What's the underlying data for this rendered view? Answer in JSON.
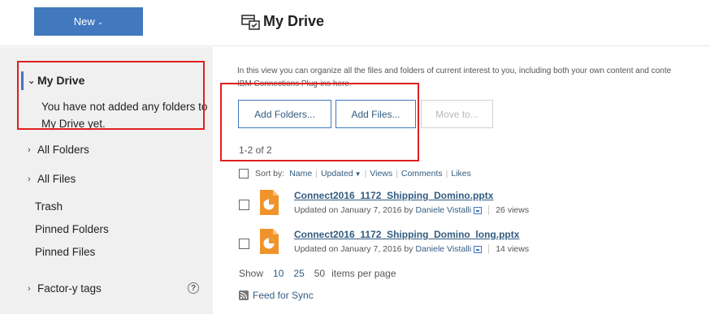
{
  "header": {
    "new_button_label": "New",
    "page_title": "My Drive"
  },
  "sidebar": {
    "my_drive_label": "My Drive",
    "my_drive_message": "You have not added any folders to My Drive yet.",
    "items": [
      {
        "label": "All Folders"
      },
      {
        "label": "All Files"
      },
      {
        "label": "Trash"
      },
      {
        "label": "Pinned Folders"
      },
      {
        "label": "Pinned Files"
      },
      {
        "label": "Factor-y tags"
      }
    ],
    "help_icon_glyph": "?"
  },
  "main": {
    "intro_line1": "In this view you can organize all the files and folders of current interest to you, including both your own content and conte",
    "intro_line2": "IBM Connections Plug-ins here.",
    "buttons": {
      "add_folders": "Add Folders...",
      "add_files": "Add Files...",
      "move_to": "Move to..."
    },
    "count_text": "1-2 of 2",
    "sort": {
      "label": "Sort by:",
      "options": [
        "Name",
        "Updated",
        "Views",
        "Comments",
        "Likes"
      ]
    },
    "files": [
      {
        "name": "Connect2016_1172_Shipping_Domino.pptx",
        "updated": "Updated on January 7, 2016 by",
        "author": "Daniele Vistalli",
        "views": "26 views",
        "icon": "presentation-file-icon"
      },
      {
        "name": "Connect2016_1172_Shipping_Domino_long.pptx",
        "updated": "Updated on January 7, 2016 by",
        "author": "Daniele Vistalli",
        "views": "14 views",
        "icon": "presentation-file-icon"
      }
    ],
    "paging": {
      "show_label": "Show",
      "options": [
        "10",
        "25",
        "50"
      ],
      "suffix": "items per page"
    },
    "feed_label": "Feed for Sync"
  },
  "colors": {
    "accent": "#4178be",
    "link": "#325c80",
    "sidebar_bg": "#f0f0f0",
    "annotation": "#e02020",
    "file_icon": "#f0932b"
  }
}
